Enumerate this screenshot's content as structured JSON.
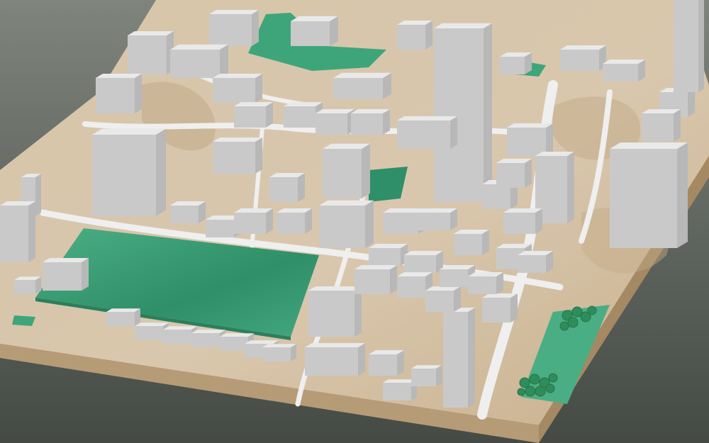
{
  "scene": {
    "subject": "3d-city-block-model",
    "colors": {
      "background_top": "#7f857d",
      "background_bottom": "#454a45",
      "ground": "#d8c6ab",
      "ground_side": "#b69b77",
      "ground_front": "#a58963",
      "roads": "#ececec",
      "park": "#3ea57a",
      "park_dark": "#2f8f68",
      "trees": "#2f8d5b",
      "building_top": "#e9e9e9",
      "building_left": "#c9c9c9",
      "building_right": "#b8b8b8"
    }
  }
}
